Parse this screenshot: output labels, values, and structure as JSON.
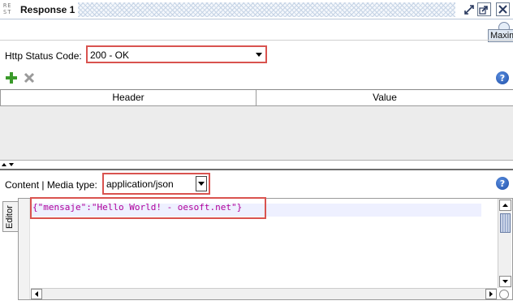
{
  "window": {
    "icon_text": "RE ST",
    "title": "Response 1"
  },
  "tooltip": {
    "text": "Maxim"
  },
  "status": {
    "label": "Http Status Code:",
    "value": "200 - OK"
  },
  "headers_table": {
    "columns": [
      "Header",
      "Value"
    ]
  },
  "content": {
    "label": "Content | Media type:",
    "media_type": "application/json"
  },
  "editor": {
    "tab_label": "Editor",
    "code": "{\"mensaje\":\"Hello World! - oesoft.net\"}"
  },
  "icons": {
    "add": "plus-icon",
    "delete": "close-icon",
    "help": "help-icon",
    "restore": "restore-icon",
    "maximize": "maximize-icon",
    "close": "close-window-icon"
  },
  "colors": {
    "highlight_border": "#d9534f",
    "code_text": "#b0009a",
    "add_green": "#3a9a2a",
    "help_blue": "#1f4fa8"
  }
}
